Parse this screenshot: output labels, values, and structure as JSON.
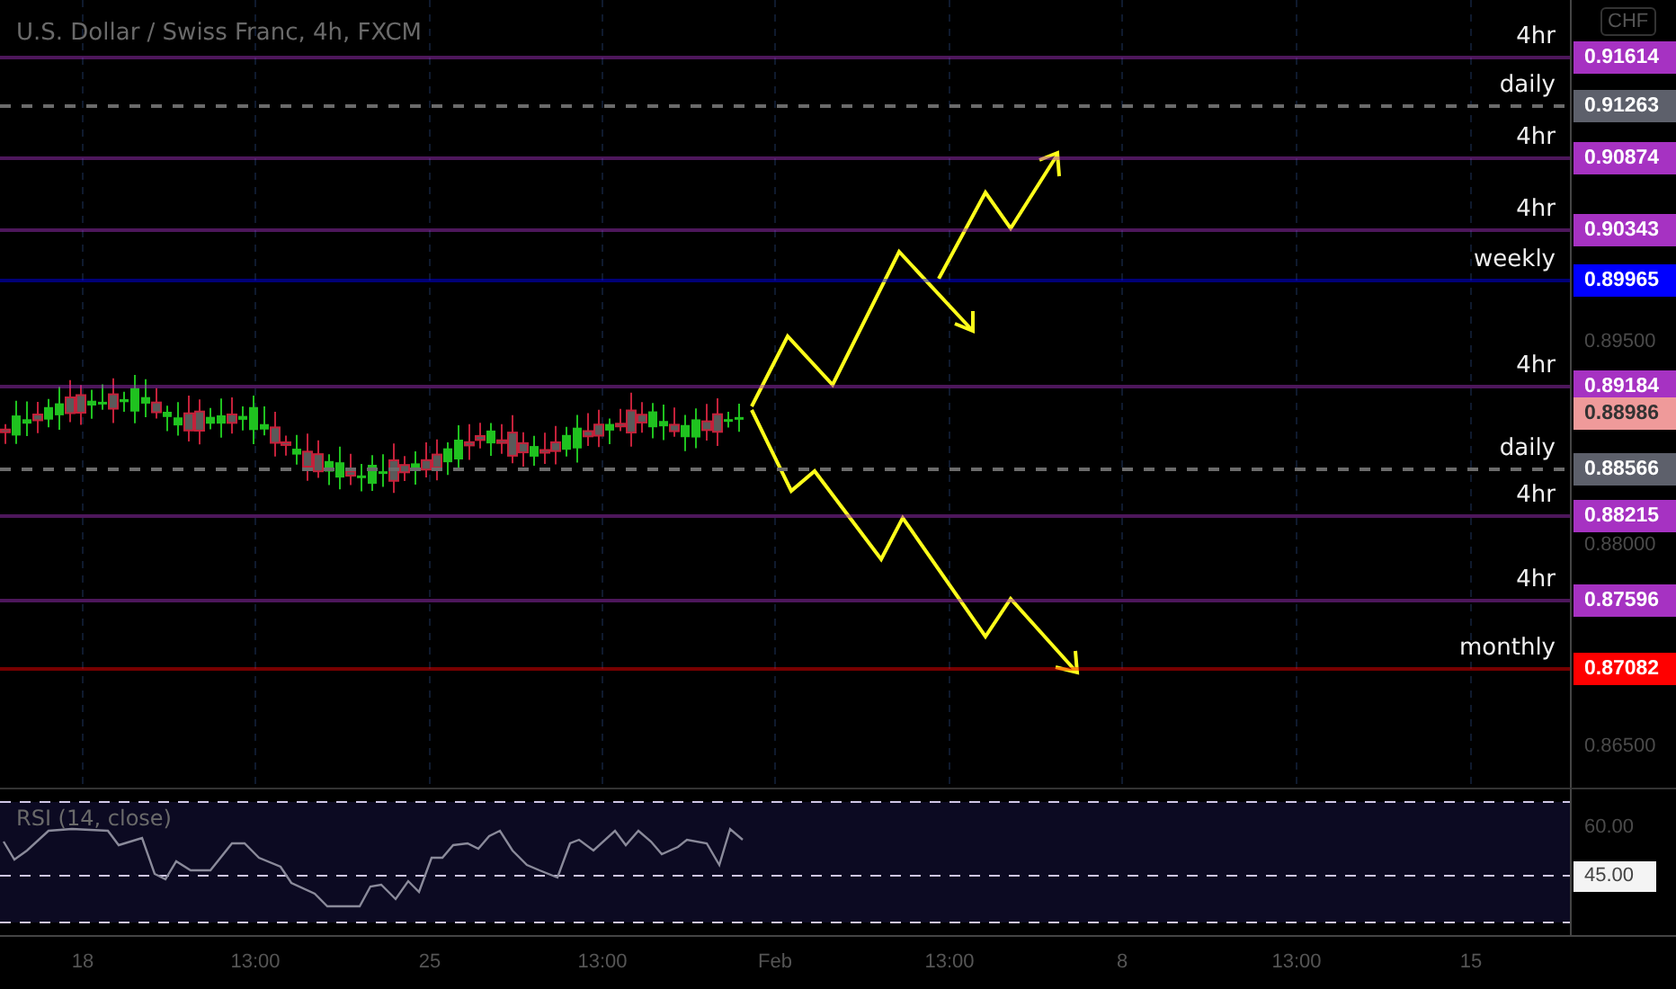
{
  "title": "U.S. Dollar / Swiss Franc, 4h, FXCM",
  "currency_badge": "CHF",
  "levels": [
    {
      "label": "4hr",
      "value": "0.91614",
      "color": "#a632c2",
      "dashed": false
    },
    {
      "label": "daily",
      "value": "0.91263",
      "color": "#5d606b",
      "dashed": true
    },
    {
      "label": "4hr",
      "value": "0.90874",
      "color": "#a632c2",
      "dashed": false
    },
    {
      "label": "4hr",
      "value": "0.90343",
      "color": "#a632c2",
      "dashed": false
    },
    {
      "label": "weekly",
      "value": "0.89965",
      "color": "#0000ff",
      "dashed": false
    },
    {
      "label": "4hr",
      "value": "0.89184",
      "color": "#a632c2",
      "dashed": false
    },
    {
      "label": "daily",
      "value": "0.88566",
      "color": "#5d606b",
      "dashed": true
    },
    {
      "label": "4hr",
      "value": "0.88215",
      "color": "#a632c2",
      "dashed": false
    },
    {
      "label": "4hr",
      "value": "0.87596",
      "color": "#a632c2",
      "dashed": false
    },
    {
      "label": "monthly",
      "value": "0.87082",
      "color": "#ff0000",
      "dashed": false
    }
  ],
  "current_price": {
    "value": "0.88986",
    "color": "#ef9a9a"
  },
  "price_ticks": [
    "0.89500",
    "0.88000",
    "0.86500"
  ],
  "rsi": {
    "title": "RSI (14, close)",
    "ticks": [
      "60.00"
    ],
    "level_badge": "45.00"
  },
  "time_labels": [
    "18",
    "13:00",
    "25",
    "13:00",
    "Feb",
    "13:00",
    "8",
    "13:00",
    "15"
  ]
}
